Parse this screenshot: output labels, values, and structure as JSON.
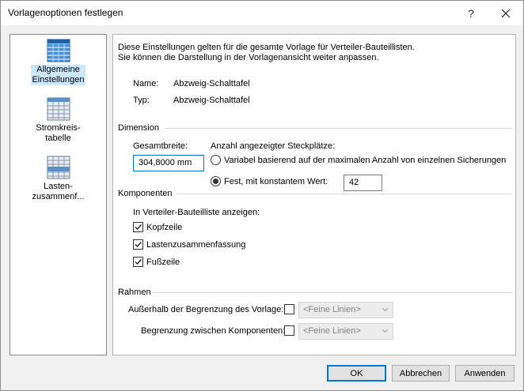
{
  "window": {
    "title": "Vorlagenoptionen festlegen",
    "help_label": "?",
    "close_label": "✕"
  },
  "nav": {
    "items": [
      {
        "label_1": "Allgemeine",
        "label_2": "Einstellungen",
        "icon": "table-grid-blue-icon",
        "selected": true
      },
      {
        "label_1": "Stromkreis-",
        "label_2": "tabelle",
        "icon": "table-grid-grey-icon",
        "selected": false
      },
      {
        "label_1": "Lasten-",
        "label_2": "zusammenf...",
        "icon": "table-grid-summary-icon",
        "selected": false
      }
    ]
  },
  "general": {
    "description_1": "Diese Einstellungen gelten für die gesamte Vorlage für Verteiler-Bauteillisten.",
    "description_2": "Sie können die Darstellung in der Vorlagenansicht weiter anpassen.",
    "name_label": "Name:",
    "name_value": "Abzweig-Schalttafel",
    "type_label": "Typ:",
    "type_value": "Abzweig-Schalttafel"
  },
  "dimension": {
    "heading": "Dimension",
    "width_label": "Gesamtbreite:",
    "width_value": "304,8000 mm",
    "slots_label": "Anzahl angezeigter Steckplätze:",
    "option_variable": "Variabel basierend auf der maximalen Anzahl von einzelnen Sicherungen",
    "option_fixed": "Fest, mit konstantem Wert:",
    "fixed_value": "42",
    "selected_option": "fixed"
  },
  "components": {
    "heading": "Komponenten",
    "show_label": "In Verteiler-Bauteilliste anzeigen:",
    "header_row": {
      "label": "Kopfzeile",
      "checked": true
    },
    "load_summary": {
      "label": "Lastenzusammenfassung",
      "checked": true
    },
    "footer": {
      "label": "Fußzeile",
      "checked": true
    }
  },
  "frame": {
    "heading": "Rahmen",
    "outside_label": "Außerhalb der Begrenzung des Vorlage:",
    "outside_checked": false,
    "outside_style": "<Feine Linien>",
    "between_label": "Begrenzung zwischen Komponenten:",
    "between_checked": false,
    "between_style": "<Feine Linien>"
  },
  "footer_buttons": {
    "ok": "OK",
    "cancel": "Abbrechen",
    "apply": "Anwenden"
  },
  "colors": {
    "selection": "#cce8ff",
    "focus_border": "#0078d7",
    "icon_blue": "#1e6fc7"
  }
}
